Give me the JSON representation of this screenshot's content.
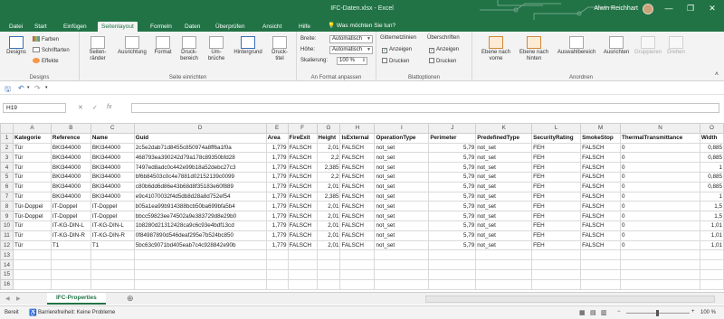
{
  "window": {
    "title": "IFC-Daten.xlsx - Excel",
    "user": "Alwin Reichhart",
    "minimize": "—",
    "restore": "❐",
    "close": "✕"
  },
  "tabs": [
    "Datei",
    "Start",
    "Einfügen",
    "Seitenlayout",
    "Formeln",
    "Daten",
    "Überprüfen",
    "Ansicht",
    "Hilfe"
  ],
  "tell_me": "Was möchten Sie tun?",
  "ribbon": {
    "designs": {
      "label": "Designs",
      "btn": "Designs",
      "farben": "Farben",
      "schriftarten": "Schriftarten",
      "effekte": "Effekte"
    },
    "seite_einrichten": {
      "label": "Seite einrichten",
      "seitenraender": "Seiten-ränder",
      "ausrichtung": "Ausrichtung",
      "format": "Format",
      "druckbereich": "Druck-bereich",
      "umbrueche": "Um-brüche",
      "hintergrund": "Hintergrund",
      "drucktitel": "Druck-titel"
    },
    "an_format": {
      "label": "An Format anpassen",
      "breite": "Breite:",
      "breite_val": "Automatisch",
      "hoehe": "Höhe:",
      "hoehe_val": "Automatisch",
      "skalierung": "Skalierung:",
      "skalierung_val": "100 %"
    },
    "blattoptionen": {
      "label": "Blattoptionen",
      "gitternetz": "Gitternetzlinien",
      "ueberschriften": "Überschriften",
      "anzeigen1": "Anzeigen",
      "drucken1": "Drucken",
      "anzeigen2": "Anzeigen",
      "drucken2": "Drucken"
    },
    "anordnen": {
      "label": "Anordnen",
      "ebene_vor": "Ebene nach vorne",
      "ebene_hinten": "Ebene nach hinten",
      "auswahlbereich": "Auswahlbereich",
      "ausrichten": "Ausrichten",
      "gruppieren": "Gruppieren",
      "drehen": "Drehen"
    }
  },
  "formula_bar": {
    "name_box": "H19",
    "cancel": "✕",
    "enter": "✓",
    "fx": "fx",
    "value": ""
  },
  "columns": [
    "A",
    "B",
    "C",
    "D",
    "E",
    "F",
    "G",
    "H",
    "I",
    "J",
    "K",
    "L",
    "M",
    "N",
    "O"
  ],
  "header_row": [
    "Kategorie",
    "Reference",
    "Name",
    "Guid",
    "Area",
    "FireExit",
    "Height",
    "IsExternal",
    "OperationType",
    "Perimeter",
    "PredefinedType",
    "SecurityRating",
    "SmokeStop",
    "ThermalTransmittance",
    "Width"
  ],
  "rows": [
    [
      "Tür",
      "BKI344000",
      "BKI344000",
      "2c5e2dab71d8455c850974a8ff6a1f0a",
      "1,779",
      "FALSCH",
      "2,01",
      "FALSCH",
      "not_set",
      "5,79",
      "not_set",
      "FEH",
      "FALSCH",
      "0",
      "0,885"
    ],
    [
      "Tür",
      "BKI344000",
      "BKI344000",
      "468793ea390242d79a178c89350bfd28",
      "1,779",
      "FALSCH",
      "2,2",
      "FALSCH",
      "not_set",
      "5,79",
      "not_set",
      "FEH",
      "FALSCH",
      "0",
      "0,885"
    ],
    [
      "Tür",
      "BKI344000",
      "BKI344000",
      "7497ed8adc0c442e99b18a52debc27c3",
      "1,779",
      "FALSCH",
      "2,385",
      "FALSCH",
      "not_set",
      "5,79",
      "not_set",
      "FEH",
      "FALSCH",
      "0",
      "1"
    ],
    [
      "Tür",
      "BKI344000",
      "BKI344000",
      "bf6b84503c0c4e7881d02152139c0099",
      "1,779",
      "FALSCH",
      "2,2",
      "FALSCH",
      "not_set",
      "5,79",
      "not_set",
      "FEH",
      "FALSCH",
      "0",
      "0,885"
    ],
    [
      "Tür",
      "BKI344000",
      "BKI344000",
      "c80b6dd6d86e43b68d8f35183e60f889",
      "1,779",
      "FALSCH",
      "2,01",
      "FALSCH",
      "not_set",
      "5,79",
      "not_set",
      "FEH",
      "FALSCH",
      "0",
      "0,885"
    ],
    [
      "Tür",
      "BKI344000",
      "BKI344000",
      "e9c41070032f4d5db8d28a8d752ef54",
      "1,779",
      "FALSCH",
      "2,385",
      "FALSCH",
      "not_set",
      "5,79",
      "not_set",
      "FEH",
      "FALSCH",
      "0",
      "1"
    ],
    [
      "Tür-Doppel",
      "IT-Doppel",
      "IT-Doppel",
      "b05a1ea99b914388bcb50ba699bfa5b4",
      "1,779",
      "FALSCH",
      "2,01",
      "FALSCH",
      "not_set",
      "5,79",
      "not_set",
      "FEH",
      "FALSCH",
      "0",
      "1,5"
    ],
    [
      "Tür-Doppel",
      "IT-Doppel",
      "IT-Doppel",
      "bbcc59823ee74502a9e383729d8e29b0",
      "1,779",
      "FALSCH",
      "2,01",
      "FALSCH",
      "not_set",
      "5,79",
      "not_set",
      "FEH",
      "FALSCH",
      "0",
      "1,5"
    ],
    [
      "Tür",
      "IT-KG-DIN-L",
      "IT-KG-DIN-L",
      "1b8280d21312428ca9c6c93e4bdf13cd",
      "1,779",
      "FALSCH",
      "2,01",
      "FALSCH",
      "not_set",
      "5,79",
      "not_set",
      "FEH",
      "FALSCH",
      "0",
      "1,01"
    ],
    [
      "Tür",
      "IT-KG-DIN-R",
      "IT-KG-DIN-R",
      "0f84987890d546deaf295e7b524bc850",
      "1,779",
      "FALSCH",
      "2,01",
      "FALSCH",
      "not_set",
      "5,79",
      "not_set",
      "FEH",
      "FALSCH",
      "0",
      "1,01"
    ],
    [
      "Tür",
      "T1",
      "T1",
      "5bc63c9071bd405eab7c4c928842e90b",
      "1,779",
      "FALSCH",
      "2,01",
      "FALSCH",
      "not_set",
      "5,79",
      "not_set",
      "FEH",
      "FALSCH",
      "0",
      "1,01"
    ]
  ],
  "sheet_tab": "IFC-Properties",
  "status": {
    "ready": "Bereit",
    "accessibility": "Barrierefreiheit: Keine Probleme",
    "zoom": "100 %"
  },
  "colors": {
    "excel_green": "#217346",
    "ribbon_bg": "#f3f3f3"
  }
}
